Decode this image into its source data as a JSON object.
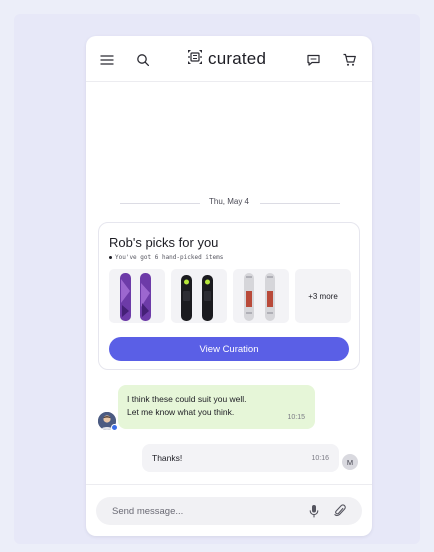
{
  "header": {
    "brand": "curated",
    "icons": [
      "menu-icon",
      "search-icon",
      "chat-icon",
      "cart-icon"
    ]
  },
  "conversation": {
    "date_divider": "Thu, May 4",
    "card": {
      "title": "Rob's picks for you",
      "subtitle": "You've got 6 hand-picked items",
      "more_label": "+3 more",
      "button_label": "View Curation"
    },
    "incoming": {
      "text": "I think these could suit you well.\nLet me know what you think.",
      "time": "10:15"
    },
    "outgoing": {
      "text": "Thanks!",
      "time": "10:16",
      "avatar_initial": "M"
    }
  },
  "composer": {
    "placeholder": "Send message..."
  },
  "colors": {
    "accent": "#5a5fe6",
    "incoming_bubble": "#e6f6d8",
    "outgoing_bubble": "#f3f3f6",
    "page_background": "#eceef9"
  }
}
